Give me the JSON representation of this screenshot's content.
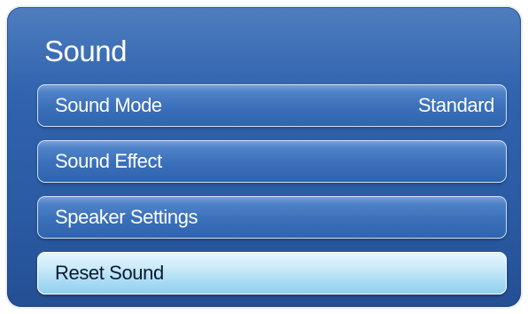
{
  "menu": {
    "title": "Sound",
    "items": [
      {
        "label": "Sound Mode",
        "value": "Standard",
        "selected": false
      },
      {
        "label": "Sound Effect",
        "value": "",
        "selected": false
      },
      {
        "label": "Speaker Settings",
        "value": "",
        "selected": false
      },
      {
        "label": "Reset Sound",
        "value": "",
        "selected": true
      }
    ]
  },
  "colors": {
    "panel": "#2f62ad",
    "item": "#3a6fb9",
    "item_selected": "#a9dbf3",
    "text": "#ffffff",
    "text_selected": "#0a1a33"
  }
}
